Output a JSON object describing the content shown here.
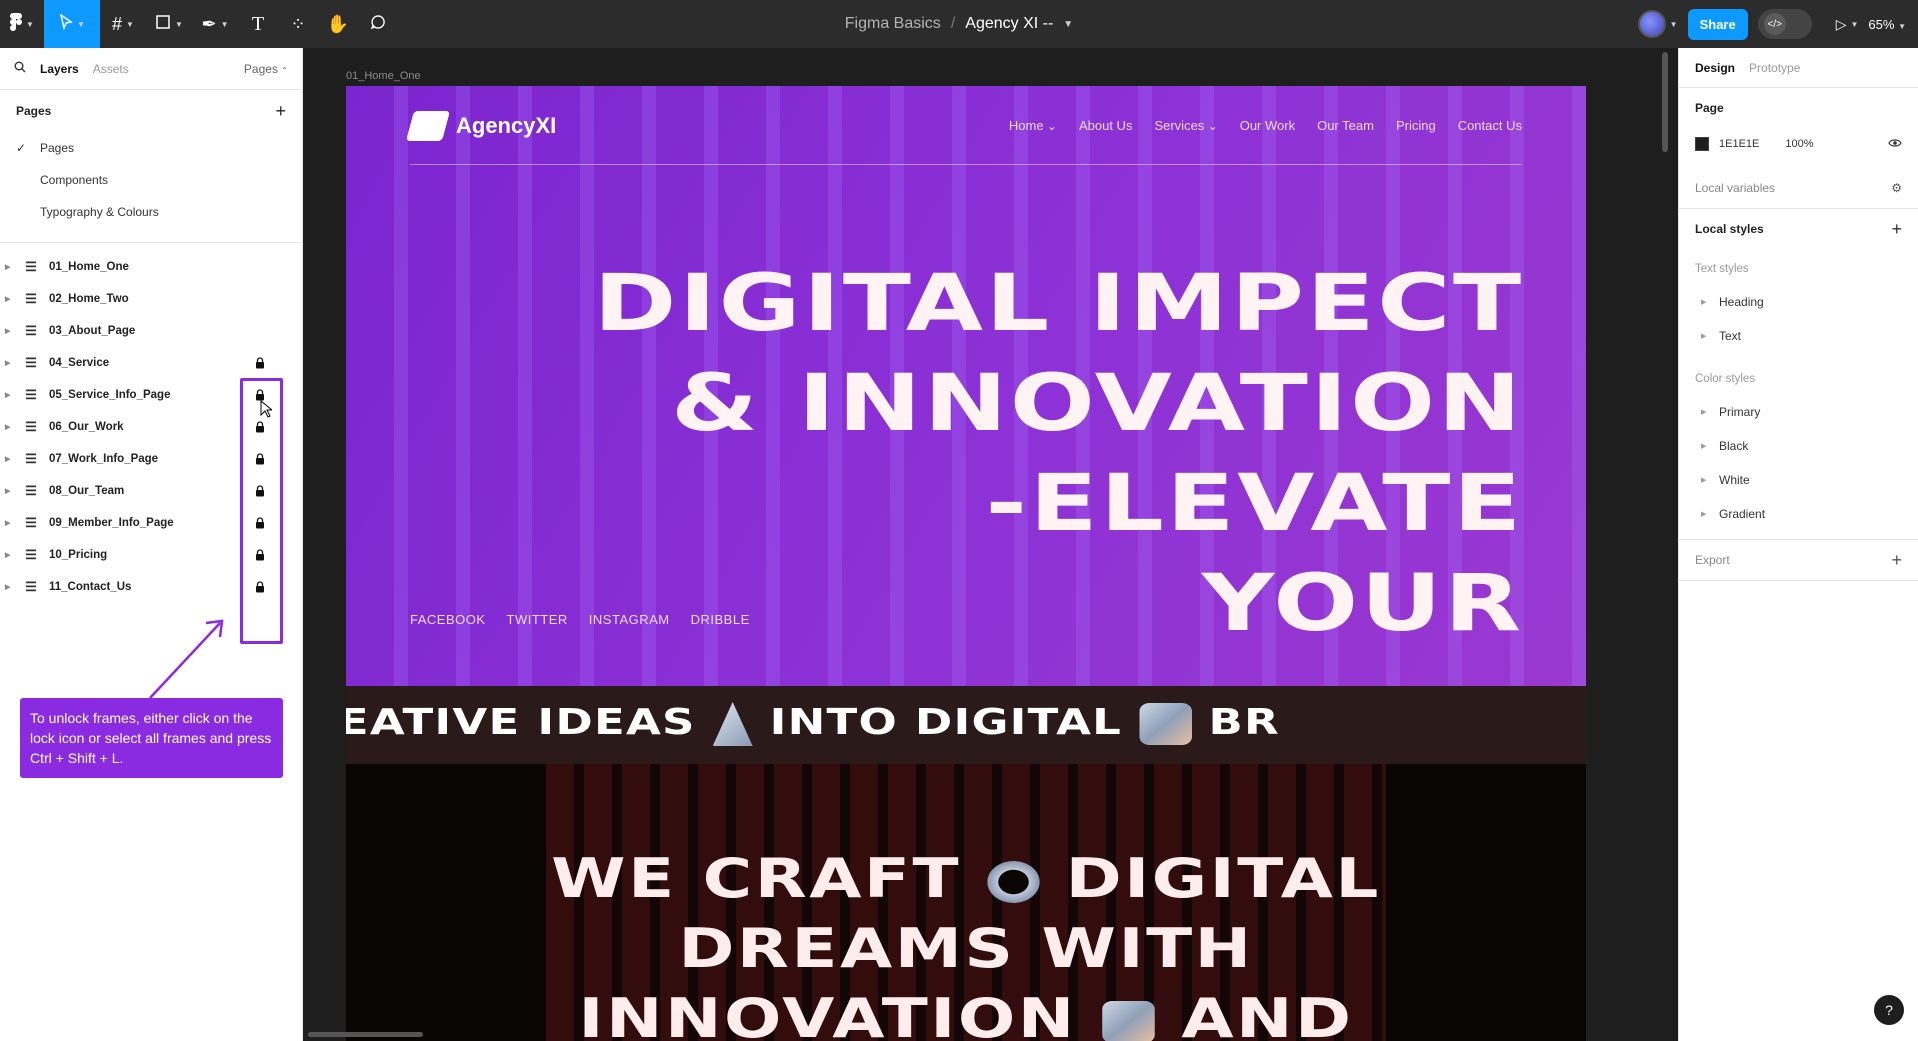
{
  "toolbar": {
    "project": "Figma Basics",
    "separator": "/",
    "file_name": "Agency XI --",
    "share_label": "Share",
    "zoom": "65%"
  },
  "left_panel": {
    "tabs": {
      "layers": "Layers",
      "assets": "Assets",
      "pages": "Pages"
    },
    "pages_heading": "Pages",
    "pages": [
      {
        "label": "Pages",
        "selected": true
      },
      {
        "label": "Components",
        "selected": false
      },
      {
        "label": "Typography & Colours",
        "selected": false
      }
    ],
    "layers": [
      {
        "label": "01_Home_One",
        "locked": false
      },
      {
        "label": "02_Home_Two",
        "locked": false
      },
      {
        "label": "03_About_Page",
        "locked": false
      },
      {
        "label": "04_Service",
        "locked": true
      },
      {
        "label": "05_Service_Info_Page",
        "locked": true
      },
      {
        "label": "06_Our_Work",
        "locked": true
      },
      {
        "label": "07_Work_Info_Page",
        "locked": true
      },
      {
        "label": "08_Our_Team",
        "locked": true
      },
      {
        "label": "09_Member_Info_Page",
        "locked": true
      },
      {
        "label": "10_Pricing",
        "locked": true
      },
      {
        "label": "11_Contact_Us",
        "locked": true
      }
    ],
    "tooltip": "To unlock frames, either click on the lock icon or select all frames and press Ctrl + Shift + L."
  },
  "canvas": {
    "frame_label": "01_Home_One",
    "site": {
      "logo": "AgencyXI",
      "nav": [
        "Home",
        "About Us",
        "Services",
        "Our Work",
        "Our Team",
        "Pricing",
        "Contact Us"
      ],
      "headline": [
        "DIGITAL IMPECT",
        "& INNOVATION",
        "-ELEVATE",
        "YOUR"
      ],
      "social": [
        "FACEBOOK",
        "TWITTER",
        "INSTAGRAM",
        "DRIBBLE"
      ],
      "ticker": [
        "REATIVE IDEAS",
        "INTO DIGITAL",
        "BR"
      ],
      "section_headline": [
        "WE CRAFT",
        "DIGITAL",
        "DREAMS WITH",
        "INNOVATION",
        "AND"
      ]
    }
  },
  "right_panel": {
    "tabs": {
      "design": "Design",
      "prototype": "Prototype"
    },
    "page_heading": "Page",
    "page_color": "1E1E1E",
    "page_opacity": "100%",
    "local_variables": "Local variables",
    "local_styles": "Local styles",
    "text_styles_heading": "Text styles",
    "text_styles": [
      "Heading",
      "Text"
    ],
    "color_styles_heading": "Color styles",
    "color_styles": [
      "Primary",
      "Black",
      "White",
      "Gradient"
    ],
    "export": "Export",
    "help": "?"
  },
  "colors": {
    "accent": "#0d99ff",
    "annotation": "#8a2be2",
    "hero_purple": "#8a2fd4",
    "canvas_bg": "#1e1e1e"
  }
}
